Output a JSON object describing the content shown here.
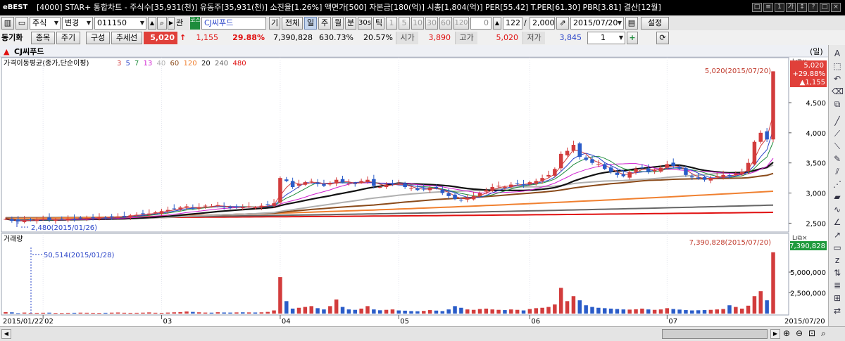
{
  "titlebar": {
    "logo": "eBEST",
    "text": "[4000] STAR+ 통합차트 - 주식수[35,931(천)] 유동주[35,931(천)] 소진율[1.26%] 액면가[500] 자본금[180(억)] 시총[1,804(억)] PER[55.42] T.PER[61.30] PBR[3.81] 결산[12월]",
    "window_buttons": [
      "□",
      "≡",
      "1",
      "가",
      "↕",
      "?",
      "□",
      "×"
    ]
  },
  "toolbar1": {
    "market_select": "주식",
    "change_select": "변경",
    "stock_code": "011150",
    "stock_badge": "코스",
    "stock_name": "CJ씨푸드",
    "period_buttons": [
      "기",
      "전체",
      "일",
      "주",
      "월",
      "분",
      "30s",
      "틱"
    ],
    "selected_period": "일",
    "minute_buttons": [
      "1",
      "5",
      "10",
      "30",
      "60",
      "120"
    ],
    "count_value": "0",
    "display_count": "122",
    "total_count": "2,000",
    "date_value": "2015/07/20",
    "settings_label": "설정"
  },
  "toolbar2": {
    "sync_label": "동기화",
    "buttons": [
      "종목",
      "주기",
      "구성",
      "추세선"
    ],
    "price": "5,020",
    "change": "1,155",
    "change_pct": "29.88%",
    "volume": "7,390,828",
    "volume_pct": "630.73%",
    "turnover_pct": "20.57%",
    "open_label": "시가",
    "open_value": "3,890",
    "high_label": "고가",
    "high_value": "5,020",
    "low_label": "저가",
    "low_value": "3,845",
    "scale_value": "1"
  },
  "chart_header": {
    "stock_name": "CJ씨푸드",
    "period_tag": "(일)"
  },
  "price_panel": {
    "indicator_label": "가격이동평균(종가,단순이평)",
    "ma_periods": [
      {
        "label": "3",
        "color": "#d23c3c"
      },
      {
        "label": "5",
        "color": "#2a44c8"
      },
      {
        "label": "7",
        "color": "#1e8c3c"
      },
      {
        "label": "13",
        "color": "#d020d0"
      },
      {
        "label": "40",
        "color": "#b0b0b0"
      },
      {
        "label": "60",
        "color": "#8a4a1a"
      },
      {
        "label": "120",
        "color": "#f08030"
      },
      {
        "label": "20",
        "color": "#111111"
      },
      {
        "label": "240",
        "color": "#666666"
      },
      {
        "label": "480",
        "color": "#e01010"
      }
    ],
    "max_annotation": "5,020(2015/07/20)",
    "min_annotation": "2,480(2015/01/26)",
    "axis_ticks": [
      "4,500",
      "4,000",
      "3,500",
      "3,000",
      "2,500"
    ],
    "price_tag": "5,020",
    "price_tag_pct": "+29.88%",
    "price_tag_change": "▲1,155"
  },
  "volume_panel": {
    "indicator_label": "거래량",
    "max_annotation": "7,390,828(2015/07/20)",
    "min_annotation": "50,514(2015/01/28)",
    "axis_ticks": [
      "5,000,000",
      "2,500,000"
    ],
    "volume_tag": "7,390,828"
  },
  "x_axis": {
    "labels": [
      "2015/01/22",
      "02",
      "03",
      "04",
      "05",
      "06",
      "07"
    ],
    "end_label": "2015/07/20"
  },
  "chart_data": {
    "type": "candlestick",
    "x_range": [
      "2015/01/22",
      "2015/07/20"
    ],
    "ylim": [
      2400,
      5200
    ],
    "volume_ylim": [
      0,
      7800000
    ],
    "moving_averages": [
      "3",
      "5",
      "7",
      "13",
      "20",
      "40",
      "60",
      "120",
      "240",
      "480"
    ],
    "last_close": 5020,
    "last_open": 3890,
    "last_high": 5020,
    "last_low": 3845,
    "last_volume": 7390828,
    "period_high": {
      "date": "2015/07/20",
      "value": 5020
    },
    "period_low": {
      "date": "2015/01/26",
      "value": 2480
    },
    "volume_min": {
      "date": "2015/01/28",
      "value": 50514
    },
    "closes": [
      2570,
      2540,
      2530,
      2550,
      2560,
      2560,
      2570,
      2550,
      2560,
      2570,
      2575,
      2570,
      2580,
      2585,
      2590,
      2595,
      2590,
      2600,
      2610,
      2620,
      2630,
      2640,
      2650,
      2660,
      2680,
      2700,
      2720,
      2740,
      2760,
      2780,
      2740,
      2760,
      2790,
      2780,
      2800,
      2770,
      2750,
      2770,
      2760,
      2780,
      2760,
      2790,
      2800,
      2830,
      3250,
      3200,
      3100,
      3150,
      3180,
      3200,
      3150,
      3120,
      3170,
      3220,
      3180,
      3160,
      3150,
      3200,
      3220,
      3120,
      3100,
      3140,
      3160,
      3150,
      3100,
      3080,
      3050,
      3060,
      3090,
      3080,
      3000,
      2950,
      2900,
      2880,
      2920,
      2950,
      3000,
      3050,
      3100,
      3120,
      3100,
      3140,
      3160,
      3130,
      3180,
      3200,
      3250,
      3300,
      3400,
      3650,
      3700,
      3800,
      3600,
      3550,
      3500,
      3480,
      3400,
      3350,
      3300,
      3280,
      3350,
      3400,
      3420,
      3350,
      3380,
      3420,
      3480,
      3450,
      3400,
      3300,
      3260,
      3240,
      3220,
      3250,
      3280,
      3300,
      3280,
      3320,
      3350,
      3500,
      3850,
      4000,
      3890,
      5020
    ],
    "volumes": [
      180000,
      150000,
      50514,
      120000,
      80000,
      90000,
      100000,
      110000,
      80000,
      70000,
      90000,
      95000,
      110000,
      100000,
      90000,
      85000,
      95000,
      110000,
      130000,
      100000,
      90000,
      95000,
      110000,
      140000,
      100000,
      90000,
      120000,
      150000,
      180000,
      250000,
      200000,
      150000,
      120000,
      110000,
      160000,
      130000,
      120000,
      140000,
      150000,
      140000,
      130000,
      150000,
      200000,
      380000,
      4400000,
      1500000,
      600000,
      700000,
      800000,
      900000,
      650000,
      500000,
      900000,
      1700000,
      800000,
      500000,
      450000,
      600000,
      900000,
      500000,
      400000,
      450000,
      500000,
      380000,
      350000,
      300000,
      280000,
      320000,
      420000,
      360000,
      300000,
      500000,
      900000,
      700000,
      500000,
      450000,
      550000,
      600000,
      500000,
      450000,
      420000,
      500000,
      450000,
      380000,
      550000,
      650000,
      700000,
      800000,
      1100000,
      3100000,
      1500000,
      2100000,
      1600000,
      1000000,
      800000,
      700000,
      650000,
      600000,
      550000,
      500000,
      480000,
      520000,
      600000,
      500000,
      450000,
      500000,
      650000,
      550000,
      480000,
      420000,
      380000,
      400000,
      420000,
      450000,
      500000,
      550000,
      1000000,
      800000,
      600000,
      950000,
      2100000,
      2700000,
      1600000,
      7390828
    ]
  }
}
